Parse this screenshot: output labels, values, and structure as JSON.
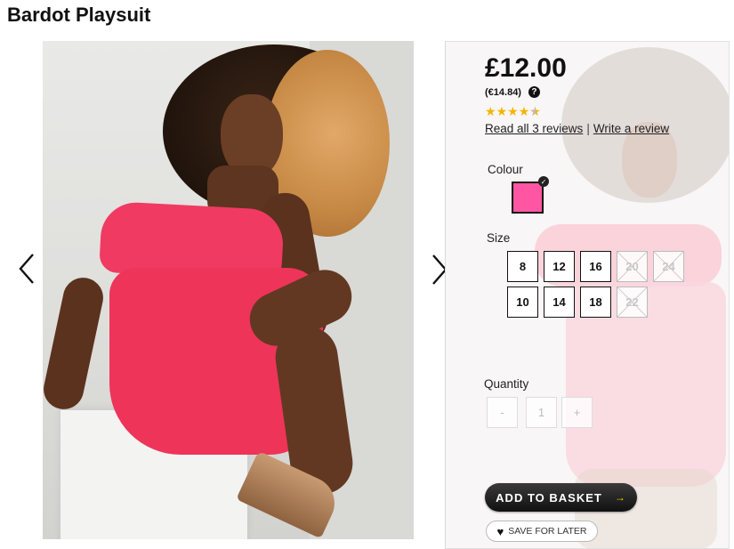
{
  "product": {
    "title": "Bardot Playsuit",
    "price": "£12.00",
    "price_eur": "(€14.84)",
    "rating": 4.5,
    "rating_max": 5
  },
  "reviews": {
    "read_all": "Read all 3 reviews",
    "separator": "|",
    "write": "Write a review"
  },
  "colour": {
    "label": "Colour",
    "selected_hex": "#ff56a4"
  },
  "size": {
    "label": "Size",
    "options": [
      {
        "label": "8",
        "available": true
      },
      {
        "label": "12",
        "available": true
      },
      {
        "label": "16",
        "available": true
      },
      {
        "label": "20",
        "available": false
      },
      {
        "label": "24",
        "available": false
      },
      {
        "label": "10",
        "available": true
      },
      {
        "label": "14",
        "available": true
      },
      {
        "label": "18",
        "available": true
      },
      {
        "label": "22",
        "available": false
      }
    ]
  },
  "quantity": {
    "label": "Quantity",
    "minus": "-",
    "value": "1",
    "plus": "+"
  },
  "actions": {
    "add_to_basket": "ADD TO BASKET",
    "save_for_later": "SAVE FOR LATER"
  },
  "icons": {
    "prev": "chevron-left-icon",
    "next": "chevron-right-icon",
    "help": "question-icon",
    "check": "check-icon",
    "heart": "heart-icon",
    "basket_arrow": "arrow-right-icon"
  },
  "colors": {
    "accent_yellow": "#ffd400",
    "star": "#f5b400",
    "dress_pink": "#ee3459"
  }
}
